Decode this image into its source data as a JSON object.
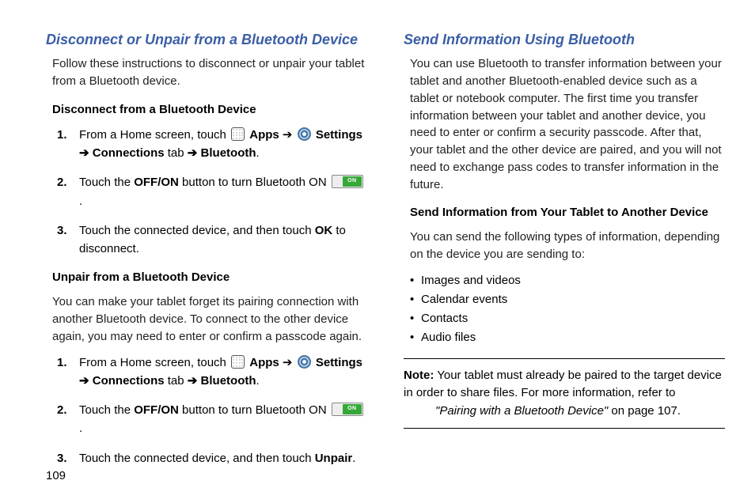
{
  "page_number": "109",
  "left": {
    "heading": "Disconnect or Unpair from a Bluetooth Device",
    "intro": "Follow these instructions to disconnect or unpair your tablet from a Bluetooth device.",
    "sectionA": {
      "title": "Disconnect from a Bluetooth Device",
      "step1_lead": "From a Home screen, touch ",
      "step1_apps": "Apps",
      "step1_arrow1": " ➔ ",
      "step1_settings": "Settings",
      "step1_row2_conn": "Connections",
      "step1_row2_tab": " tab ",
      "step1_row2_bt": "Bluetooth",
      "step2_a": "Touch the ",
      "step2_off": "OFF/ON",
      "step2_b": " button to turn Bluetooth ON ",
      "step3_a": "Touch the connected device, and then touch ",
      "step3_ok": "OK",
      "step3_b": " to disconnect."
    },
    "sectionB": {
      "title": "Unpair from a Bluetooth Device",
      "intro": "You can make your tablet forget its pairing connection with another Bluetooth device. To connect to the other device again, you may need to enter or confirm a passcode again.",
      "step1_lead": "From a Home screen, touch ",
      "step1_apps": "Apps",
      "step1_settings": "Settings",
      "step1_row2_conn": "Connections",
      "step1_row2_tab": " tab ",
      "step1_row2_bt": "Bluetooth",
      "step2_a": "Touch the ",
      "step2_off": "OFF/ON",
      "step2_b": " button to turn Bluetooth ON ",
      "step3_a": "Touch the connected device, and then touch ",
      "step3_unpair": "Unpair"
    }
  },
  "right": {
    "heading": "Send Information Using Bluetooth",
    "intro": "You can use Bluetooth to transfer information between your tablet and another Bluetooth-enabled device such as a tablet or notebook computer. The first time you transfer information between your tablet and another device, you need to enter or confirm a security passcode. After that, your tablet and the other device are paired, and you will not need to exchange pass codes to transfer information in the future.",
    "subhead": "Send Information from Your Tablet to Another Device",
    "lead": "You can send the following types of information, depending on the device you are sending to:",
    "bullets": [
      "Images and videos",
      "Calendar events",
      "Contacts",
      "Audio files"
    ],
    "note_label": "Note:",
    "note_a": " Your tablet must already be paired to the target device in order to share files. For more information, refer to ",
    "note_ref": "\"Pairing with a Bluetooth Device\"",
    "note_b": " on page 107."
  }
}
